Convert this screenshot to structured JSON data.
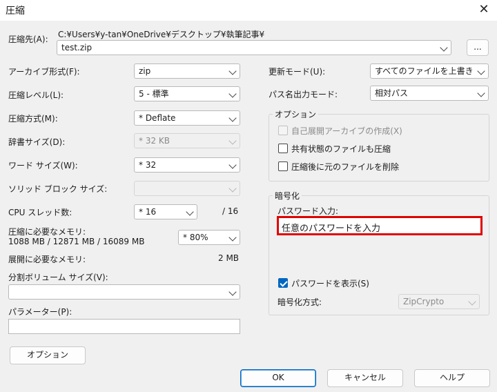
{
  "window": {
    "title": "圧縮"
  },
  "dest": {
    "label": "圧縮先(A):",
    "path": "C:¥Users¥y-tan¥OneDrive¥デスクトップ¥執筆記事¥",
    "file": "test.zip",
    "browse": "..."
  },
  "left": {
    "archive_format": {
      "label": "アーカイブ形式(F):",
      "value": "zip"
    },
    "compression_level": {
      "label": "圧縮レベル(L):",
      "value": "5 - 標準"
    },
    "compression_method": {
      "label": "圧縮方式(M):",
      "value": "* Deflate"
    },
    "dictionary_size": {
      "label": "辞書サイズ(D):",
      "value": "* 32 KB"
    },
    "word_size": {
      "label": "ワード サイズ(W):",
      "value": "* 32"
    },
    "solid_block": {
      "label": "ソリッド ブロック サイズ:",
      "value": ""
    },
    "cpu_threads": {
      "label": "CPU スレッド数:",
      "value": "* 16",
      "max": "/ 16"
    },
    "memory_compress": {
      "label": "圧縮に必要なメモリ:",
      "detail": "1088 MB / 12871 MB / 16089 MB",
      "value": "* 80%"
    },
    "memory_decompress": {
      "label": "展開に必要なメモリ:",
      "value": "2 MB"
    },
    "split_volume": {
      "label": "分割ボリューム サイズ(V):",
      "value": ""
    },
    "parameters": {
      "label": "パラメーター(P):",
      "value": ""
    },
    "options_button": "オプション"
  },
  "right": {
    "update_mode": {
      "label": "更新モード(U):",
      "value": "すべてのファイルを上書き"
    },
    "path_mode": {
      "label": "パス名出力モード:",
      "value": "相対パス"
    },
    "options_group": {
      "title": "オプション",
      "sfx": "自己展開アーカイブの作成(X)",
      "shared": "共有状態のファイルも圧縮",
      "delete_after": "圧縮後に元のファイルを削除"
    },
    "encryption": {
      "title": "暗号化",
      "password_label": "パスワード入力:",
      "password_value": "任意のパスワードを入力",
      "show_password": "パスワードを表示(S)",
      "method_label": "暗号化方式:",
      "method_value": "ZipCrypto"
    }
  },
  "buttons": {
    "ok": "OK",
    "cancel": "キャンセル",
    "help": "ヘルプ"
  }
}
